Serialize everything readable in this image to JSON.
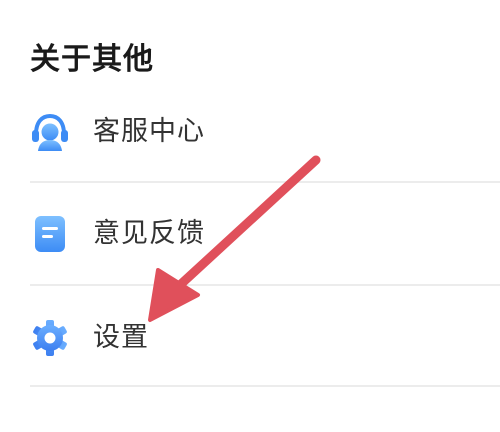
{
  "section": {
    "title": "关于其他"
  },
  "menu": {
    "items": [
      {
        "label": "客服中心",
        "icon": "headset-icon"
      },
      {
        "label": "意见反馈",
        "icon": "feedback-icon"
      },
      {
        "label": "设置",
        "icon": "gear-icon"
      }
    ]
  },
  "colors": {
    "icon_blue": "#3d8cf5",
    "icon_blue_light": "#7ec0ff",
    "divider": "#ececec",
    "annotation_arrow": "#e0505b"
  }
}
